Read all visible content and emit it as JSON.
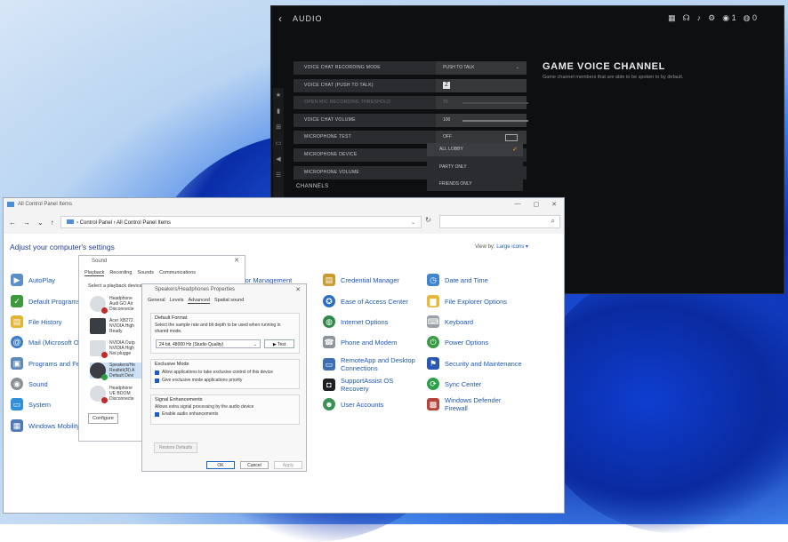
{
  "game": {
    "back_glyph": "‹",
    "title": "AUDIO",
    "top_counts": [
      "1",
      "0"
    ],
    "rows": [
      {
        "label": "VOICE CHAT RECORDING MODE",
        "value": "PUSH TO TALK",
        "dropdown": true
      },
      {
        "label": "VOICE CHAT (PUSH TO TALK)",
        "value": "",
        "check": true
      },
      {
        "label": "OPEN MIC RECORDING THRESHOLD",
        "value": "70",
        "slider": true,
        "dim": true
      },
      {
        "label": "VOICE CHAT VOLUME",
        "value": "100",
        "slider": true
      },
      {
        "label": "MICROPHONE TEST",
        "value": "OFF",
        "toggle": true
      },
      {
        "label": "MICROPHONE DEVICE",
        "value": ""
      },
      {
        "label": "MICROPHONE VOLUME",
        "value": ""
      }
    ],
    "dropdown_options": [
      {
        "label": "ALL LOBBY",
        "selected": true
      },
      {
        "label": "PARTY ONLY",
        "selected": false
      },
      {
        "label": "FRIENDS ONLY",
        "selected": false
      }
    ],
    "channels_label": "CHANNELS",
    "right_title": "GAME VOICE CHANNEL",
    "right_desc": "Game channel members that are able to be spoken to by default."
  },
  "control_panel": {
    "window_title": "All Control Panel Items",
    "address": "› Control Panel › All Control Panel Items",
    "heading": "Adjust your computer's settings",
    "view_by_label": "View by:",
    "view_by_value": "Large icons ▾",
    "col1": [
      "AutoPlay",
      "Default Programs",
      "File History",
      "Mail (Microsoft O",
      "Programs and Fea",
      "Sound",
      "System",
      "Windows Mobility"
    ],
    "col2_partial": [
      "lor Management"
    ],
    "col3": [
      "Credential Manager",
      "Ease of Access Center",
      "Internet Options",
      "Phone and Modem",
      "RemoteApp and Desktop Connections",
      "SupportAssist OS Recovery",
      "User Accounts"
    ],
    "col4": [
      "Date and Time",
      "File Explorer Options",
      "Keyboard",
      "Power Options",
      "Security and Maintenance",
      "Sync Center",
      "Windows Defender Firewall"
    ]
  },
  "sound_dialog": {
    "title": "Sound",
    "tabs": [
      "Playback",
      "Recording",
      "Sounds",
      "Communications"
    ],
    "hint": "Select a playback device t",
    "devices": [
      {
        "name": "Headphone",
        "l2": "Audi GO Air",
        "l3": "Disconnecte"
      },
      {
        "name": "Acer XB272",
        "l2": "NVIDIA High",
        "l3": "Ready"
      },
      {
        "name": "NVIDIA Outp",
        "l2": "NVIDIA High",
        "l3": "Not plugge"
      },
      {
        "name": "Speakers/He",
        "l2": "Realtek(R) A",
        "l3": "Default Devi"
      },
      {
        "name": "Headphone",
        "l2": "UE BOOM",
        "l3": "Disconnecte"
      }
    ],
    "configure": "Configure"
  },
  "props_dialog": {
    "title": "Speakers/Headphones Properties",
    "tabs": [
      "General",
      "Levels",
      "Advanced",
      "Spatial sound"
    ],
    "default_format_title": "Default Format",
    "default_format_desc": "Select the sample rate and bit depth to be used when running in shared mode.",
    "format_value": "24 bit, 48000 Hz (Studio Quality)",
    "test": "▶ Test",
    "exclusive_title": "Exclusive Mode",
    "exclusive_opts": [
      "Allow applications to take exclusive control of this device",
      "Give exclusive mode applications priority"
    ],
    "enh_title": "Signal Enhancements",
    "enh_desc": "Allows extra signal processing by the audio device",
    "enh_opt": "Enable audio enhancements",
    "restore": "Restore Defaults",
    "ok": "OK",
    "cancel": "Cancel",
    "apply": "Apply"
  }
}
